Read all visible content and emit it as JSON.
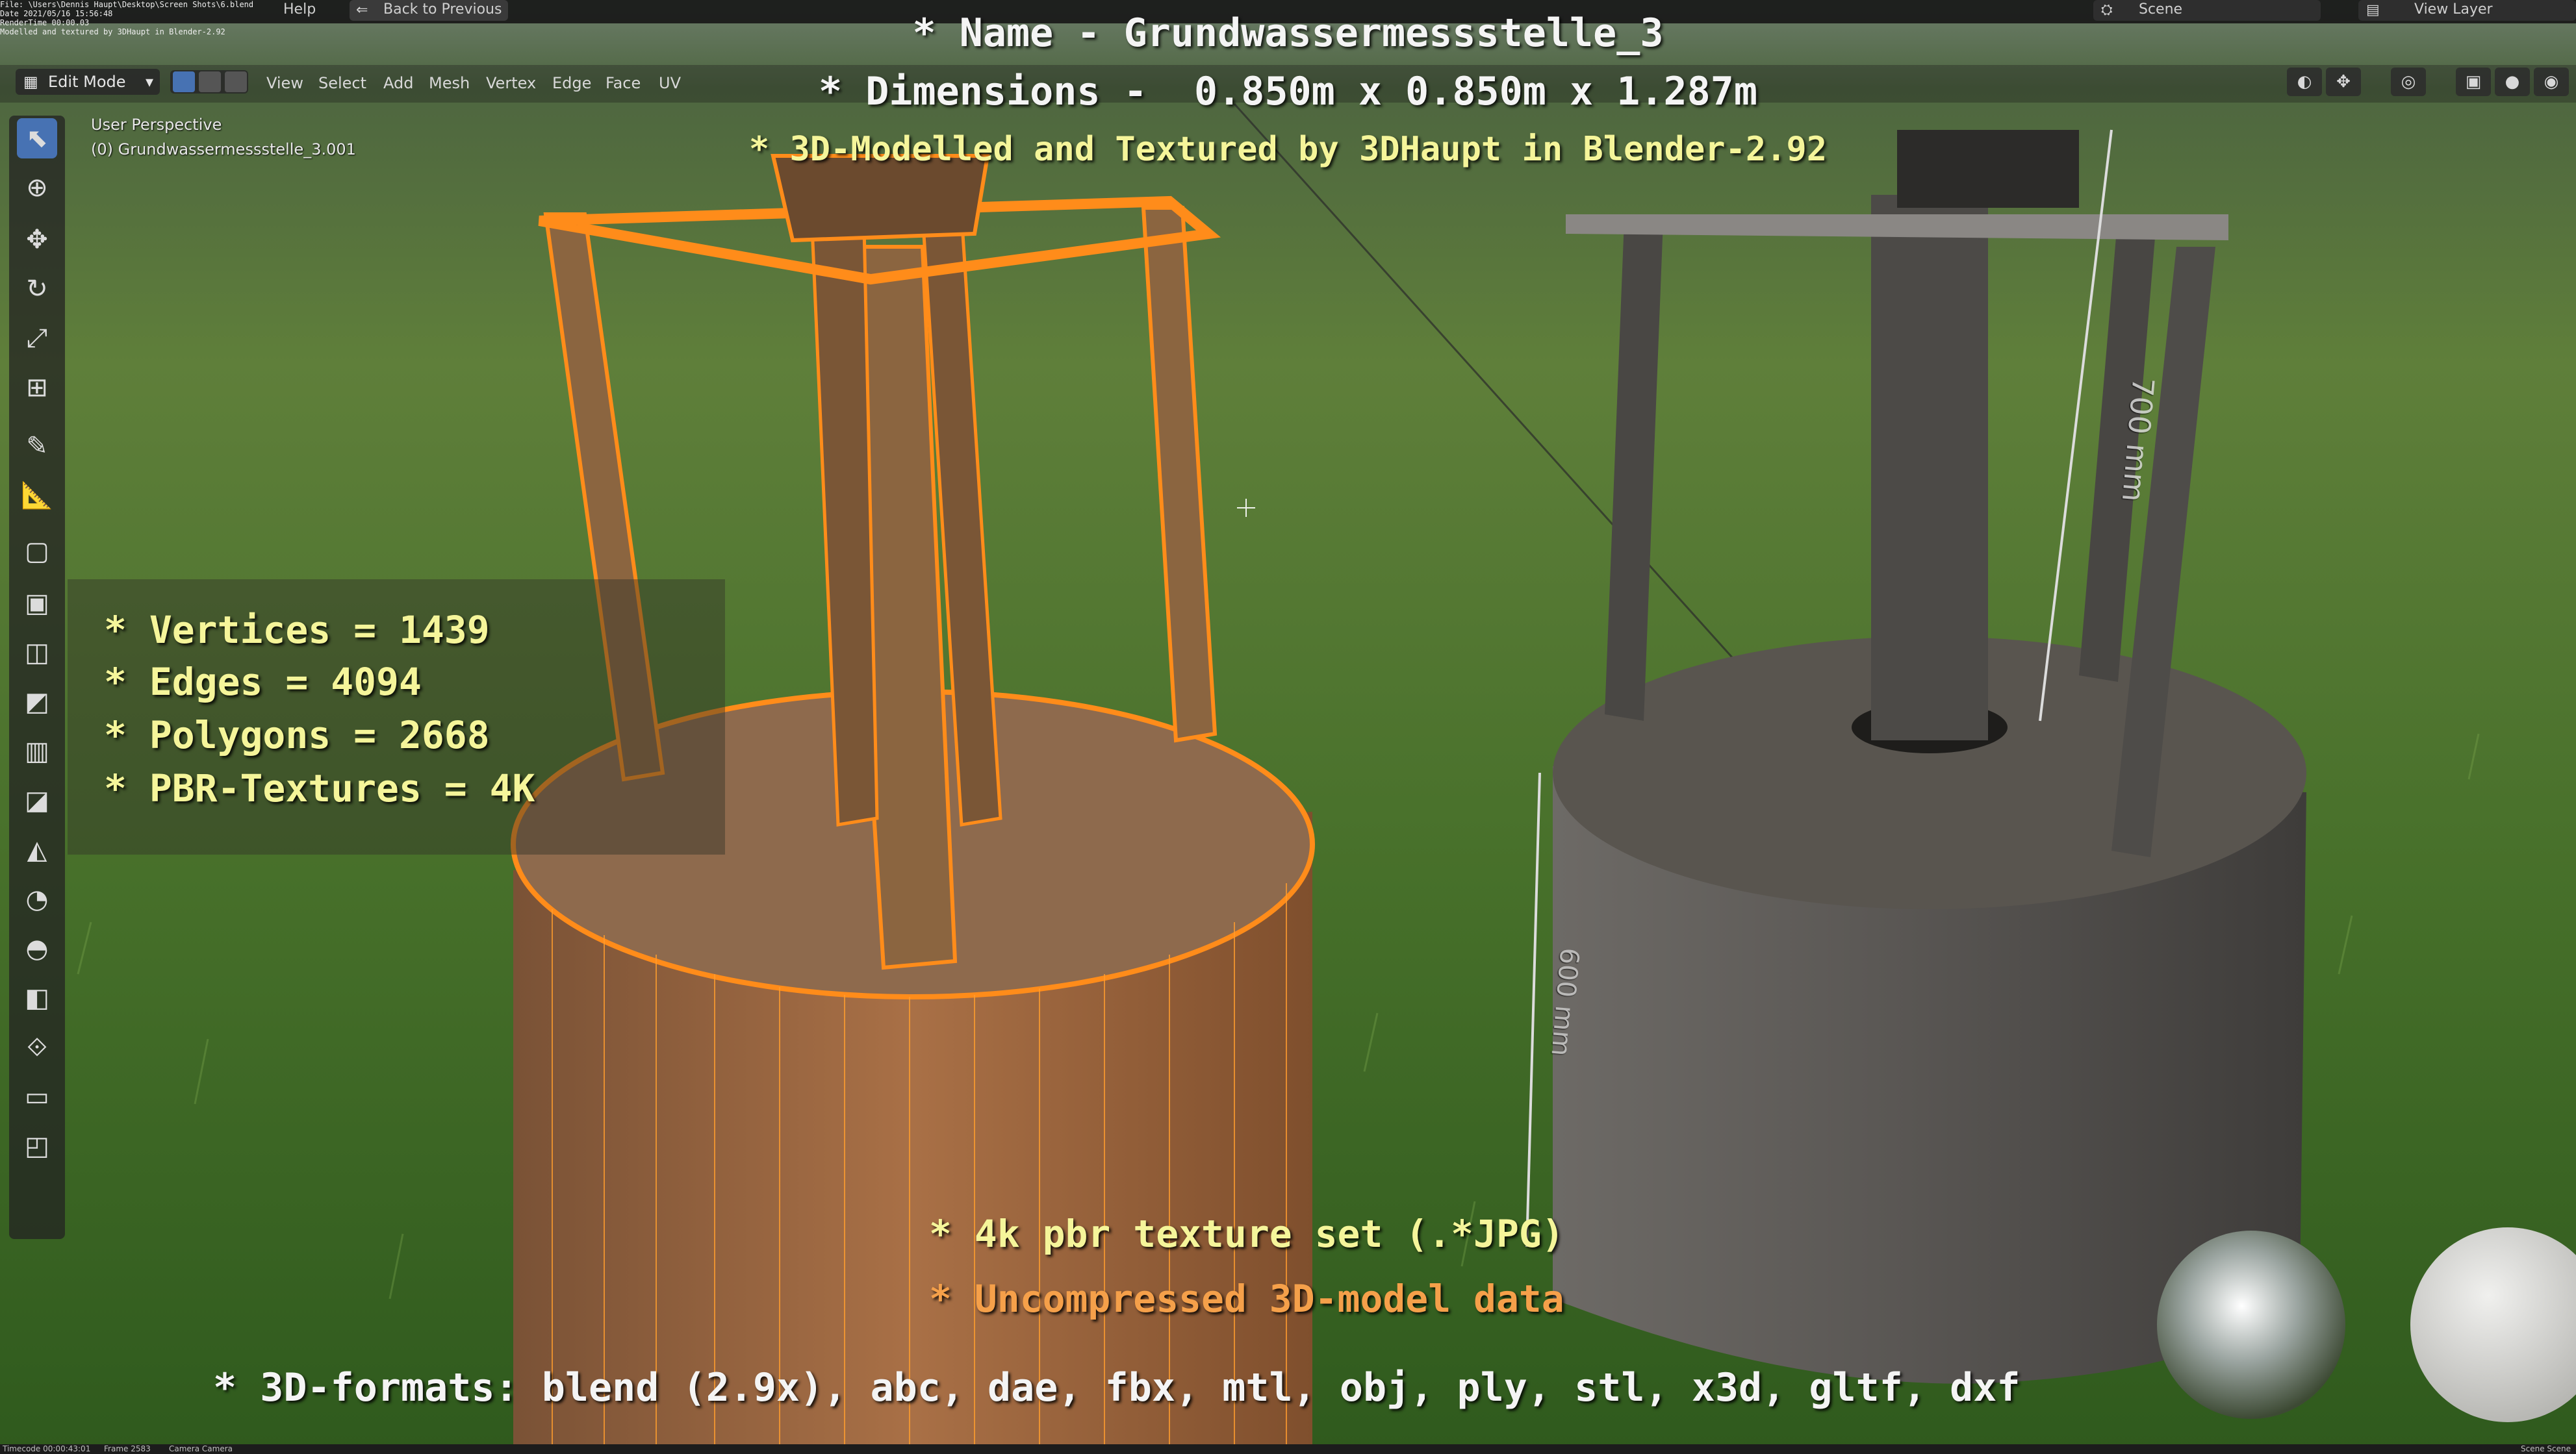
{
  "top_menu": {
    "help": "Help",
    "back": "Back to Previous",
    "scene": "Scene",
    "view_layer": "View Layer"
  },
  "corner_info": [
    "File: \\Users\\Dennis Haupt\\Desktop\\Screen Shots\\6.blend",
    "Date 2021/05/16 15:56:48",
    "RenderTime 00:00.03",
    "Modelled and textured by 3DHaupt in Blender-2.92"
  ],
  "header": {
    "mode": "Edit Mode",
    "menus": [
      "View",
      "Select",
      "Add",
      "Mesh",
      "Vertex",
      "Edge",
      "Face",
      "UV"
    ]
  },
  "viewport": {
    "perspective": "User Perspective",
    "object": "(0) Grundwassermessstelle_3.001"
  },
  "overlay": {
    "name_line": "* Name - Grundwassermessstelle_3",
    "dimensions_line": "* Dimensions -  0.850m x 0.850m x 1.287m",
    "credit_line": "* 3D-Modelled and Textured by 3DHaupt in Blender-2.92",
    "stats": [
      "* Vertices = 1439",
      "* Edges = 4094",
      "* Polygons = 2668",
      "* PBR-Textures = 4K"
    ],
    "texture_line": "* 4k pbr texture set (.*JPG)",
    "uncompressed_line": "* Uncompressed 3D-model data",
    "formats_line": "* 3D-formats: blend (2.9x), abc, dae, fbx, mtl, obj, ply, stl, x3d, gltf, dxf"
  },
  "annotations": {
    "dim_700": "700 mm",
    "dim_600": "600 mm"
  },
  "statusbar": {
    "timecode": "Timecode 00:00:43:01",
    "frame": "Frame 2583",
    "camera": "Camera Camera",
    "scene": "Scene Scene"
  },
  "colors": {
    "selection_orange": "#ff8c1a",
    "stats_yellow": "#f5f59a",
    "ui_blue": "#4772b3"
  }
}
